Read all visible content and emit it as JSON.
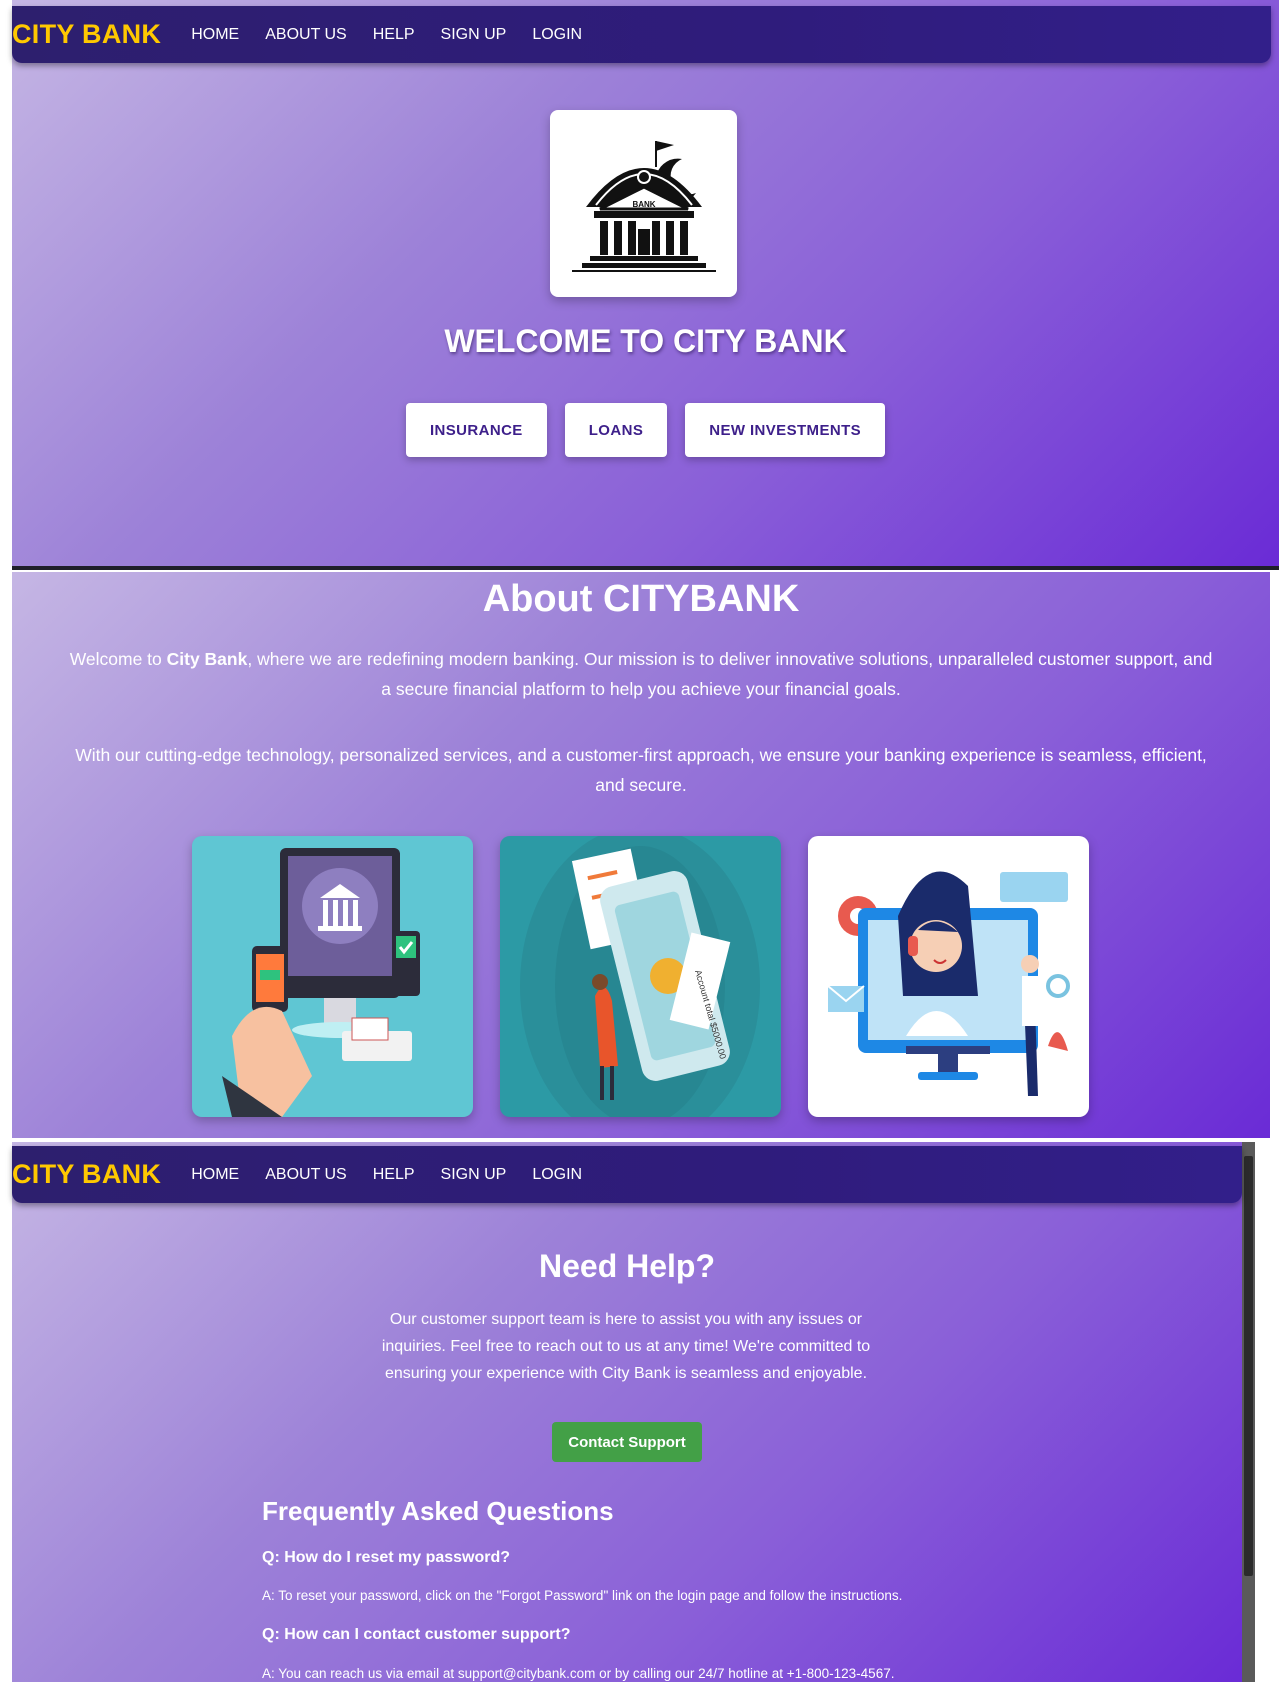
{
  "nav": {
    "brand": "CITY BANK",
    "links": [
      "HOME",
      "ABOUT US",
      "HELP",
      "SIGN UP",
      "LOGIN"
    ]
  },
  "hero": {
    "logo_text": "BANK",
    "title": "WELCOME TO CITY BANK",
    "buttons": [
      "INSURANCE",
      "LOANS",
      "NEW INVESTMENTS"
    ]
  },
  "about": {
    "title": "About CITYBANK",
    "p1_prefix": "Welcome to ",
    "p1_bold": "City Bank",
    "p1_line1_rest": ", where we are redefining modern banking. Our mission is to deliver innovative solutions, unparalleled customer support, and",
    "p1_line2": "a secure financial platform to help you achieve your financial goals.",
    "p2_line1": "With our cutting-edge technology, personalized services, and a customer-first approach, we ensure your banking experience is seamless, efficient,",
    "p2_line2": "and secure.",
    "card2_label": "Account total $5000.00"
  },
  "help": {
    "title": "Need Help?",
    "text_lines": [
      "Our customer support team is here to assist you with any issues or",
      "inquiries. Feel free to reach out to us at any time! We're committed to",
      "ensuring your experience with City Bank is seamless and enjoyable."
    ],
    "support_button": "Contact Support",
    "faq_title": "Frequently Asked Questions",
    "faqs": [
      {
        "q": "Q: How do I reset my password?",
        "a": "A: To reset your password, click on the \"Forgot Password\" link on the login page and follow the instructions."
      },
      {
        "q": "Q: How can I contact customer support?",
        "a": "A: You can reach us via email at support@citybank.com or by calling our 24/7 hotline at +1-800-123-4567."
      }
    ]
  },
  "colors": {
    "brand_yellow": "#ffc800",
    "nav_bg": "#2f1c7c",
    "button_text": "#3d1f8a",
    "support_green": "#43a047"
  }
}
